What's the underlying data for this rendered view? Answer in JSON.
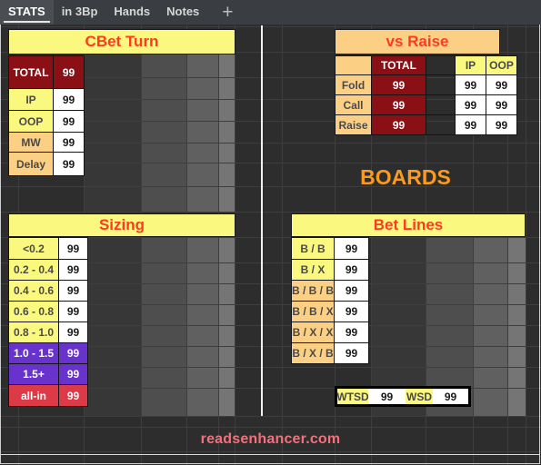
{
  "window": {
    "site_footer": "readsenhancer.com"
  },
  "tabs": {
    "items": [
      {
        "label": "STATS",
        "active": true
      },
      {
        "label": "in 3Bp",
        "active": false
      },
      {
        "label": "Hands",
        "active": false
      },
      {
        "label": "Notes",
        "active": false
      }
    ],
    "add_label": "+"
  },
  "panels": {
    "cbet_turn": {
      "title": "CBet Turn",
      "rows": [
        {
          "label": "TOTAL",
          "value": "99",
          "style": "dred"
        },
        {
          "label": "IP",
          "value": "99",
          "style": "yellow"
        },
        {
          "label": "OOP",
          "value": "99",
          "style": "yellow"
        },
        {
          "label": "MW",
          "value": "99",
          "style": "orange"
        },
        {
          "label": "Delay",
          "value": "99",
          "style": "orange"
        }
      ]
    },
    "vs_raise": {
      "title": "vs Raise",
      "columns": [
        "",
        "TOTAL",
        "IP",
        "OOP"
      ],
      "rows": [
        {
          "label": "Fold",
          "total": "99",
          "ip": "99",
          "oop": "99"
        },
        {
          "label": "Call",
          "total": "99",
          "ip": "99",
          "oop": "99"
        },
        {
          "label": "Raise",
          "total": "99",
          "ip": "99",
          "oop": "99"
        }
      ]
    },
    "boards": {
      "title": "BOARDS"
    },
    "sizing": {
      "title": "Sizing",
      "rows": [
        {
          "label": "<0.2",
          "value": "99",
          "style": "yellow"
        },
        {
          "label": "0.2 - 0.4",
          "value": "99",
          "style": "yellow"
        },
        {
          "label": "0.4 - 0.6",
          "value": "99",
          "style": "yellow"
        },
        {
          "label": "0.6 - 0.8",
          "value": "99",
          "style": "yellow"
        },
        {
          "label": "0.8 - 1.0",
          "value": "99",
          "style": "yellow"
        },
        {
          "label": "1.0 - 1.5",
          "value": "99",
          "style": "purple"
        },
        {
          "label": "1.5+",
          "value": "99",
          "style": "purple"
        },
        {
          "label": "all-in",
          "value": "99",
          "style": "red"
        }
      ]
    },
    "bet_lines": {
      "title": "Bet Lines",
      "rows": [
        {
          "label": "B / B",
          "value": "99",
          "style": "yellow"
        },
        {
          "label": "B / X",
          "value": "99",
          "style": "yellow"
        },
        {
          "label": "B / B / B",
          "value": "99",
          "style": "orange"
        },
        {
          "label": "B / B / X",
          "value": "99",
          "style": "orange"
        },
        {
          "label": "B / X / X",
          "value": "99",
          "style": "orange"
        },
        {
          "label": "B / X / B",
          "value": "99",
          "style": "orange"
        }
      ]
    },
    "showdown": {
      "wtsd_label": "WTSD",
      "wtsd_value": "99",
      "wsd_label": "WSD",
      "wsd_value": "99"
    }
  },
  "colors": {
    "accent_red": "#ff3b1f",
    "header_yellow": "#faf87f",
    "header_orange": "#fbd085",
    "total_dark_red": "#8a1016",
    "purple": "#6733cc",
    "allin_red": "#dd3a47",
    "boards_orange": "#f99b20",
    "footer_pink": "#f4707a",
    "app_background": "#2d2d2d",
    "tabbar_background": "#3a3e42"
  }
}
